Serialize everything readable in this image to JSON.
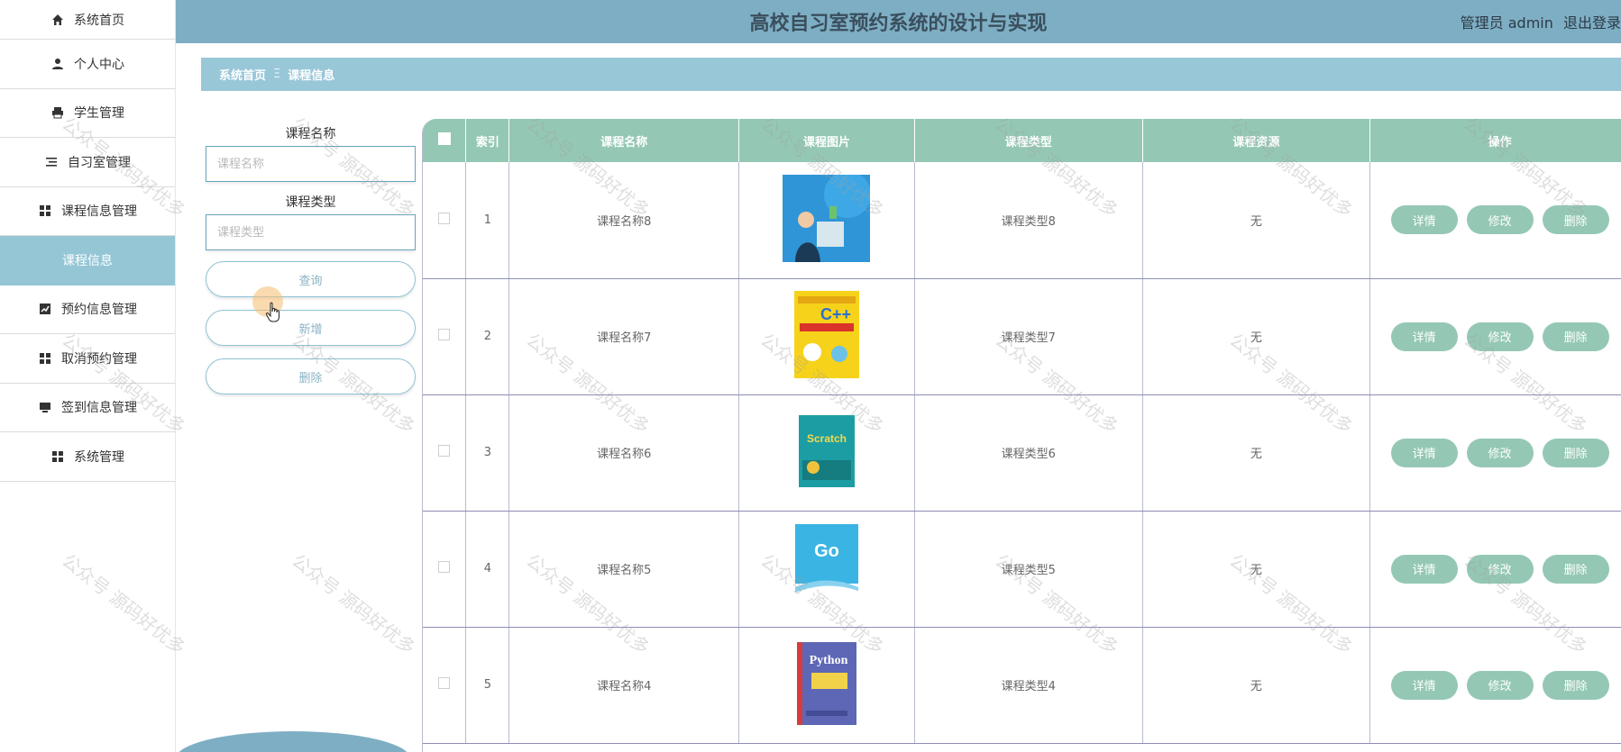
{
  "header": {
    "title": "高校自习室预约系统的设计与实现",
    "user_role": "管理员 admin",
    "logout": "退出登录"
  },
  "sidebar": {
    "items": [
      {
        "label": "系统首页",
        "icon": "home-icon",
        "active": false
      },
      {
        "label": "个人中心",
        "icon": "user-icon",
        "active": false
      },
      {
        "label": "学生管理",
        "icon": "printer-icon",
        "active": false
      },
      {
        "label": "自习室管理",
        "icon": "list-icon",
        "active": false
      },
      {
        "label": "课程信息管理",
        "icon": "grid-icon",
        "active": false
      },
      {
        "label": "课程信息",
        "icon": "",
        "active": true
      },
      {
        "label": "预约信息管理",
        "icon": "chart-icon",
        "active": false
      },
      {
        "label": "取消预约管理",
        "icon": "grid-icon",
        "active": false
      },
      {
        "label": "签到信息管理",
        "icon": "monitor-icon",
        "active": false
      },
      {
        "label": "系统管理",
        "icon": "grid-icon",
        "active": false
      }
    ]
  },
  "breadcrumb": {
    "home": "系统首页",
    "separator": "Ξ",
    "current": "课程信息"
  },
  "search": {
    "name_label": "课程名称",
    "name_placeholder": "课程名称",
    "type_label": "课程类型",
    "type_placeholder": "课程类型",
    "query_button": "查询",
    "add_button": "新增",
    "delete_button": "删除"
  },
  "table": {
    "headers": [
      "索引",
      "课程名称",
      "课程图片",
      "课程类型",
      "课程资源",
      "操作"
    ],
    "rows": [
      {
        "index": "1",
        "name": "课程名称8",
        "type": "课程类型8",
        "resource": "无",
        "cover": "illustration"
      },
      {
        "index": "2",
        "name": "课程名称7",
        "type": "课程类型7",
        "resource": "无",
        "cover": "C++"
      },
      {
        "index": "3",
        "name": "课程名称6",
        "type": "课程类型6",
        "resource": "无",
        "cover": "Scratch"
      },
      {
        "index": "4",
        "name": "课程名称5",
        "type": "课程类型5",
        "resource": "无",
        "cover": "Go"
      },
      {
        "index": "5",
        "name": "课程名称4",
        "type": "课程类型4",
        "resource": "无",
        "cover": "Python"
      }
    ],
    "actions": {
      "detail": "详情",
      "edit": "修改",
      "delete": "删除"
    }
  },
  "watermark": "公众号 源码好优多",
  "colors": {
    "header_bg": "#7eaec4",
    "breadcrumb_bg": "#98c7d8",
    "table_header_bg": "#94c8b4",
    "action_button_bg": "#94c8b4",
    "sidebar_active_bg": "#94c6d6"
  }
}
